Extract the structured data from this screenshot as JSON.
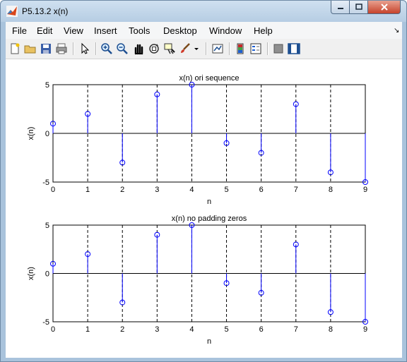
{
  "window": {
    "title": "P5.13.2 x(n)"
  },
  "menu": [
    "File",
    "Edit",
    "View",
    "Insert",
    "Tools",
    "Desktop",
    "Window",
    "Help"
  ],
  "toolbar_icons": [
    "new-figure-icon",
    "open-file-icon",
    "save-icon",
    "print-icon",
    "pointer-icon",
    "zoom-in-icon",
    "zoom-out-icon",
    "pan-icon",
    "rotate-3d-icon",
    "data-cursor-icon",
    "brush-icon",
    "dropdown-arrow-icon",
    "link-plot-icon",
    "colorbar-icon",
    "legend-icon",
    "hide-plot-tools-icon",
    "show-plot-tools-icon"
  ],
  "colors": {
    "stem": "#0000ff",
    "axis": "#000000",
    "grid": "#000000"
  },
  "chart_data": [
    {
      "type": "stem",
      "title": "x(n) ori sequence",
      "xlabel": "n",
      "ylabel": "x(n)",
      "x": [
        0,
        1,
        2,
        3,
        4,
        5,
        6,
        7,
        8,
        9
      ],
      "values": [
        1,
        2,
        -3,
        4,
        5,
        -1,
        -2,
        3,
        -4,
        -5
      ],
      "xlim": [
        0,
        9
      ],
      "ylim": [
        -5,
        5
      ],
      "xticks": [
        "0",
        "1",
        "2",
        "3",
        "4",
        "5",
        "6",
        "7",
        "8",
        "9"
      ],
      "yticks": [
        "-5",
        "0",
        "5"
      ],
      "grid": "x dashed"
    },
    {
      "type": "stem",
      "title": "x(n) no padding zeros",
      "xlabel": "n",
      "ylabel": "x(n)",
      "x": [
        0,
        1,
        2,
        3,
        4,
        5,
        6,
        7,
        8,
        9
      ],
      "values": [
        1,
        2,
        -3,
        4,
        5,
        -1,
        -2,
        3,
        -4,
        -5
      ],
      "xlim": [
        0,
        9
      ],
      "ylim": [
        -5,
        5
      ],
      "xticks": [
        "0",
        "1",
        "2",
        "3",
        "4",
        "5",
        "6",
        "7",
        "8",
        "9"
      ],
      "yticks": [
        "-5",
        "0",
        "5"
      ],
      "grid": "x dashed"
    }
  ]
}
